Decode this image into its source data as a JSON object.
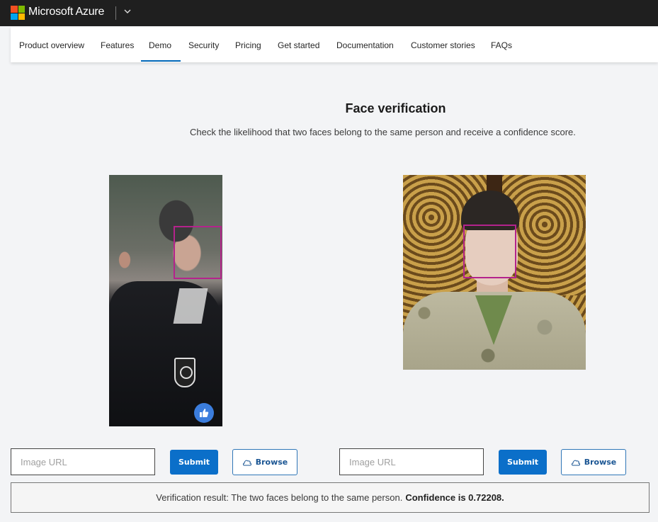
{
  "header": {
    "brand": "Microsoft Azure",
    "brand_icon": "microsoft-logo-icon",
    "menu_icon": "chevron-down-icon"
  },
  "nav": {
    "items": [
      {
        "label": "Product overview",
        "active": false
      },
      {
        "label": "Features",
        "active": false
      },
      {
        "label": "Demo",
        "active": true
      },
      {
        "label": "Security",
        "active": false
      },
      {
        "label": "Pricing",
        "active": false
      },
      {
        "label": "Get started",
        "active": false
      },
      {
        "label": "Documentation",
        "active": false
      },
      {
        "label": "Customer stories",
        "active": false
      },
      {
        "label": "FAQs",
        "active": false
      }
    ],
    "active_color": "#0067b8"
  },
  "main": {
    "title": "Face verification",
    "subtitle": "Check the likelihood that two faces belong to the same person and receive a confidence score.",
    "images": [
      {
        "description": "Profile of young man with short dark hair in black shirt with shoulder patch, crowd background",
        "face_box": true,
        "overlay_icon": "thumbs-up-icon"
      },
      {
        "description": "Young man with short dark hair in camouflage military uniform in front of ornate wooden window",
        "face_box": true
      }
    ],
    "face_box_color": "#b4238c"
  },
  "controls": [
    {
      "input_placeholder": "Image URL",
      "input_value": "",
      "submit_label": "Submit",
      "browse_label": "Browse",
      "browse_icon": "upload-cloud-icon"
    },
    {
      "input_placeholder": "Image URL",
      "input_value": "",
      "submit_label": "Submit",
      "browse_label": "Browse",
      "browse_icon": "upload-cloud-icon"
    }
  ],
  "result": {
    "text": "Verification result: The two faces belong to the same person.",
    "confidence_text": "Confidence is 0.72208.",
    "confidence": 0.72208
  },
  "colors": {
    "primary_button": "#0b6fc9",
    "topbar": "#1f1f1f",
    "background": "#f3f4f6"
  }
}
